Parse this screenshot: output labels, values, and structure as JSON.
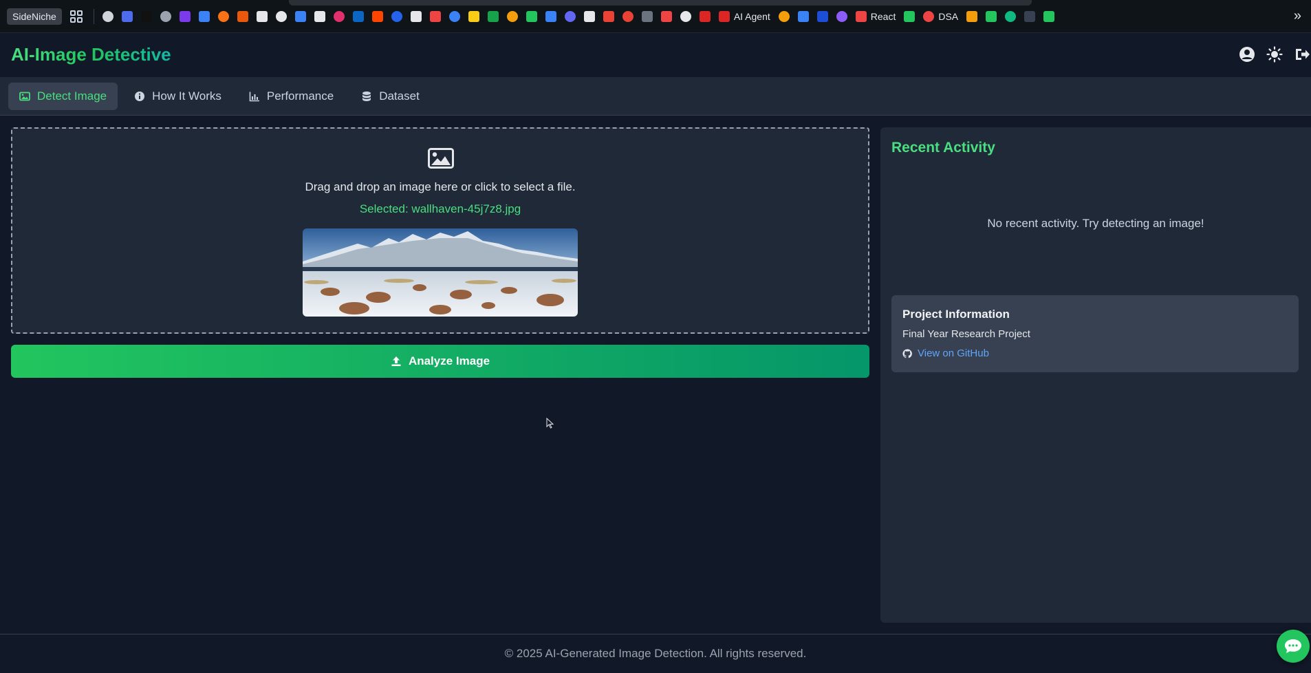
{
  "bookmarks_bar": {
    "first_item": "SideNiche",
    "items": [
      {
        "icon": "chatgpt-icon",
        "label": "",
        "color": "#d1d5db"
      },
      {
        "icon": "deepseek-icon",
        "label": "",
        "color": "#4f6bed"
      },
      {
        "icon": "grok-icon",
        "label": "",
        "color": "#111111"
      },
      {
        "icon": "ai-icon",
        "label": "",
        "color": "#9ca3af"
      },
      {
        "icon": "star-of-david-icon",
        "label": "",
        "color": "#7c3aed"
      },
      {
        "icon": "butterfly-icon",
        "label": "",
        "color": "#3b82f6"
      },
      {
        "icon": "claude-icon",
        "label": "",
        "color": "#f97316"
      },
      {
        "icon": "gmail-m-icon",
        "label": "",
        "color": "#ea580c"
      },
      {
        "icon": "notion-icon",
        "label": "",
        "color": "#e5e7eb"
      },
      {
        "icon": "framer-icon",
        "label": "",
        "color": "#e5e7eb"
      },
      {
        "icon": "docs-icon",
        "label": "",
        "color": "#3b82f6"
      },
      {
        "icon": "x-twitter-icon",
        "label": "",
        "color": "#e5e7eb"
      },
      {
        "icon": "instagram-icon",
        "label": "",
        "color": "#e1306c"
      },
      {
        "icon": "linkedin-icon",
        "label": "",
        "color": "#0a66c2"
      },
      {
        "icon": "reddit-icon",
        "label": "",
        "color": "#ff4500"
      },
      {
        "icon": "bookmark-blue-icon",
        "label": "",
        "color": "#2563eb"
      },
      {
        "icon": "github-icon",
        "label": "",
        "color": "#e5e7eb"
      },
      {
        "icon": "youtube-icon",
        "label": "",
        "color": "#ef4444"
      },
      {
        "icon": "gemini-icon",
        "label": "",
        "color": "#3b82f6"
      },
      {
        "icon": "codeforces-icon",
        "label": "",
        "color": "#facc15"
      },
      {
        "icon": "gfg-icon",
        "label": "",
        "color": "#16a34a"
      },
      {
        "icon": "pinwheel-icon",
        "label": "",
        "color": "#f59e0b"
      },
      {
        "icon": "whatsapp-icon",
        "label": "",
        "color": "#22c55e"
      },
      {
        "icon": "docs-icon",
        "label": "",
        "color": "#3b82f6"
      },
      {
        "icon": "list-icon",
        "label": "",
        "color": "#6366f1"
      },
      {
        "icon": "circle-icon",
        "label": "",
        "color": "#e5e7eb"
      },
      {
        "icon": "gmail-icon",
        "label": "",
        "color": "#ea4335"
      },
      {
        "icon": "gmail-icon",
        "label": "",
        "color": "#ea4335"
      },
      {
        "icon": "hashnode-icon",
        "label": "",
        "color": "#6b7280"
      },
      {
        "icon": "x-red-icon",
        "label": "",
        "color": "#ef4444"
      },
      {
        "icon": "terminal-icon",
        "label": "",
        "color": "#e5e7eb"
      },
      {
        "icon": "tuf-icon",
        "label": "",
        "color": "#dc2626"
      },
      {
        "icon": "agent-icon",
        "label": "AI Agent",
        "color": "#dc2626"
      },
      {
        "icon": "person-icon",
        "label": "",
        "color": "#f59e0b"
      },
      {
        "icon": "c-icon",
        "label": "",
        "color": "#3b82f6"
      },
      {
        "icon": "photo-icon",
        "label": "",
        "color": "#1d4ed8"
      },
      {
        "icon": "star-pink-icon",
        "label": "",
        "color": "#8b5cf6"
      },
      {
        "icon": "youtube-icon",
        "label": "React",
        "color": "#ef4444"
      },
      {
        "icon": "maps-icon",
        "label": "",
        "color": "#22c55e"
      },
      {
        "icon": "youtube-icon",
        "label": "DSA",
        "color": "#ef4444"
      },
      {
        "icon": "grid-color-icon",
        "label": "",
        "color": "#f59e0b"
      },
      {
        "icon": "circle-green-icon",
        "label": "",
        "color": "#22c55e"
      },
      {
        "icon": "mail-green-icon",
        "label": "",
        "color": "#10b981"
      },
      {
        "icon": "terminal-dark-icon",
        "label": "",
        "color": "#374151"
      },
      {
        "icon": "pin-green-icon",
        "label": "",
        "color": "#22c55e"
      }
    ]
  },
  "header": {
    "title": "AI-Image Detective",
    "icons": [
      "user-circle-icon",
      "sun-icon",
      "logout-icon"
    ]
  },
  "tabs": [
    {
      "label": "Detect Image",
      "icon": "image-icon",
      "active": true
    },
    {
      "label": "How It Works",
      "icon": "info-icon",
      "active": false
    },
    {
      "label": "Performance",
      "icon": "chart-icon",
      "active": false
    },
    {
      "label": "Dataset",
      "icon": "database-icon",
      "active": false
    }
  ],
  "upload": {
    "prompt": "Drag and drop an image here or click to select a file.",
    "selected_text": "Selected: wallhaven-45j7z8.jpg"
  },
  "analyze_button": {
    "label": "Analyze Image"
  },
  "recent_activity": {
    "title": "Recent Activity",
    "empty_text": "No recent activity. Try detecting an image!"
  },
  "project_info": {
    "title": "Project Information",
    "subtitle": "Final Year Research Project",
    "link_label": "View on GitHub"
  },
  "footer": {
    "text": "© 2025 AI-Generated Image Detection. All rights reserved."
  },
  "colors": {
    "accent": "#4ade80",
    "button_start": "#22c55e",
    "button_end": "#059669",
    "link": "#60a5fa",
    "background": "#111827",
    "panel": "#1f2937"
  }
}
